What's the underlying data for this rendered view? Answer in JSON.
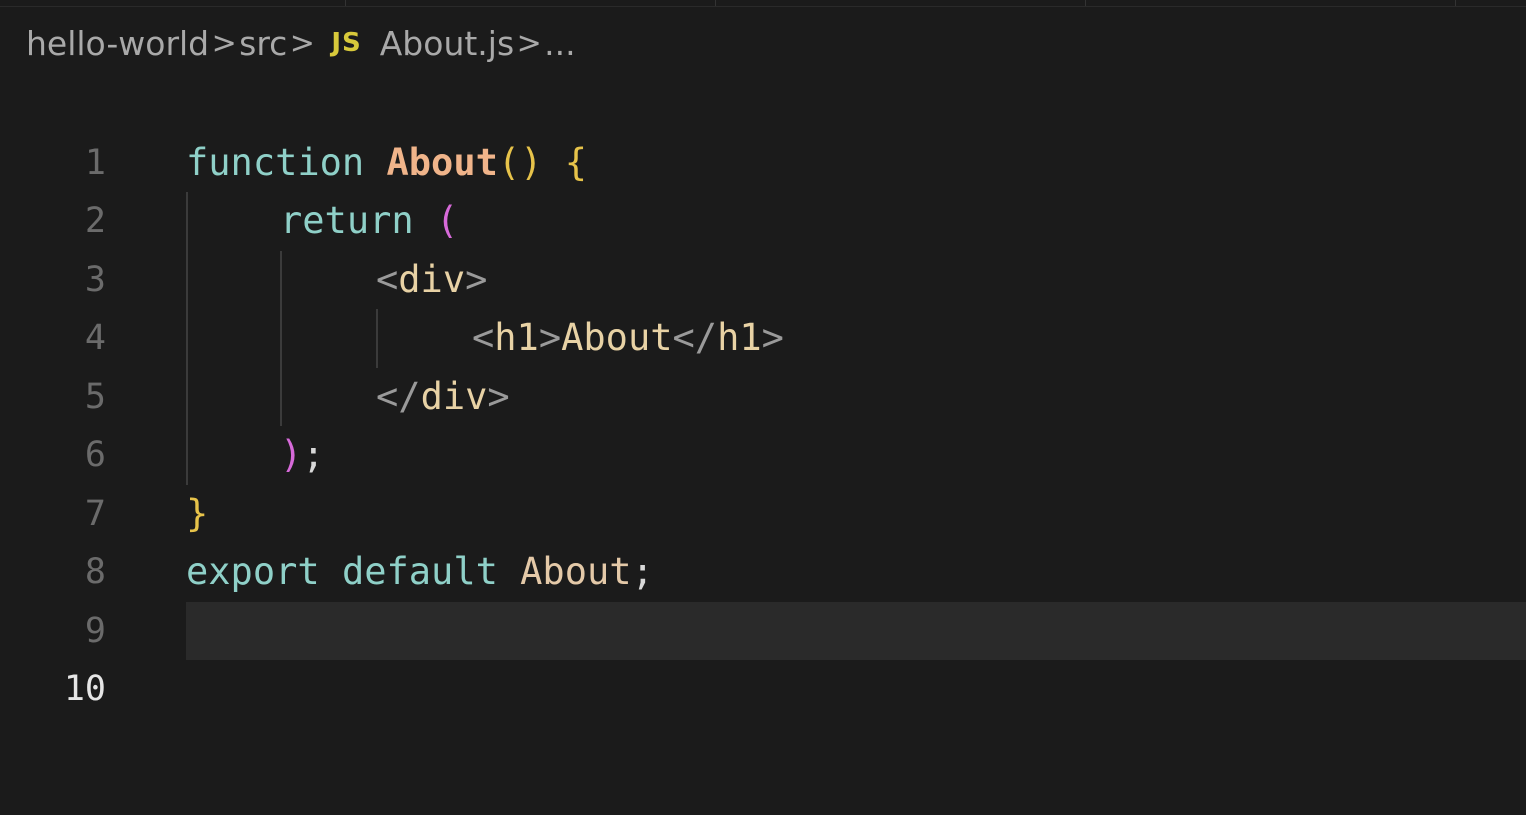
{
  "breadcrumb": {
    "items": [
      "hello-world",
      "src",
      "About.js",
      "..."
    ],
    "separator": ">",
    "file_icon": "JS"
  },
  "editor": {
    "current_line": 10,
    "lines": [
      {
        "n": "1"
      },
      {
        "n": "2"
      },
      {
        "n": "3"
      },
      {
        "n": "4"
      },
      {
        "n": "5"
      },
      {
        "n": "6"
      },
      {
        "n": "7"
      },
      {
        "n": "8"
      },
      {
        "n": "9"
      },
      {
        "n": "10"
      }
    ],
    "tokens": {
      "l2": [
        "function",
        " ",
        "About",
        "()",
        " ",
        "{"
      ],
      "l3": [
        "return",
        " ",
        "("
      ],
      "l4": [
        "<",
        "div",
        ">"
      ],
      "l5": [
        "<",
        "h1",
        ">",
        "About",
        "</",
        "h1",
        ">"
      ],
      "l6": [
        "</",
        "div",
        ">"
      ],
      "l7": [
        ")",
        ";"
      ],
      "l8": [
        "}"
      ],
      "l9": [
        "export",
        " ",
        "default",
        " ",
        "About",
        ";"
      ]
    }
  },
  "colors": {
    "background": "#1b1b1b",
    "current_line_bg": "#2a2a2a",
    "keyword": "#8fd0c8",
    "function_name": "#f0b48a",
    "brace": "#e7c34a",
    "paren_level2": "#d76ad9",
    "js_icon": "#d8c93b"
  }
}
